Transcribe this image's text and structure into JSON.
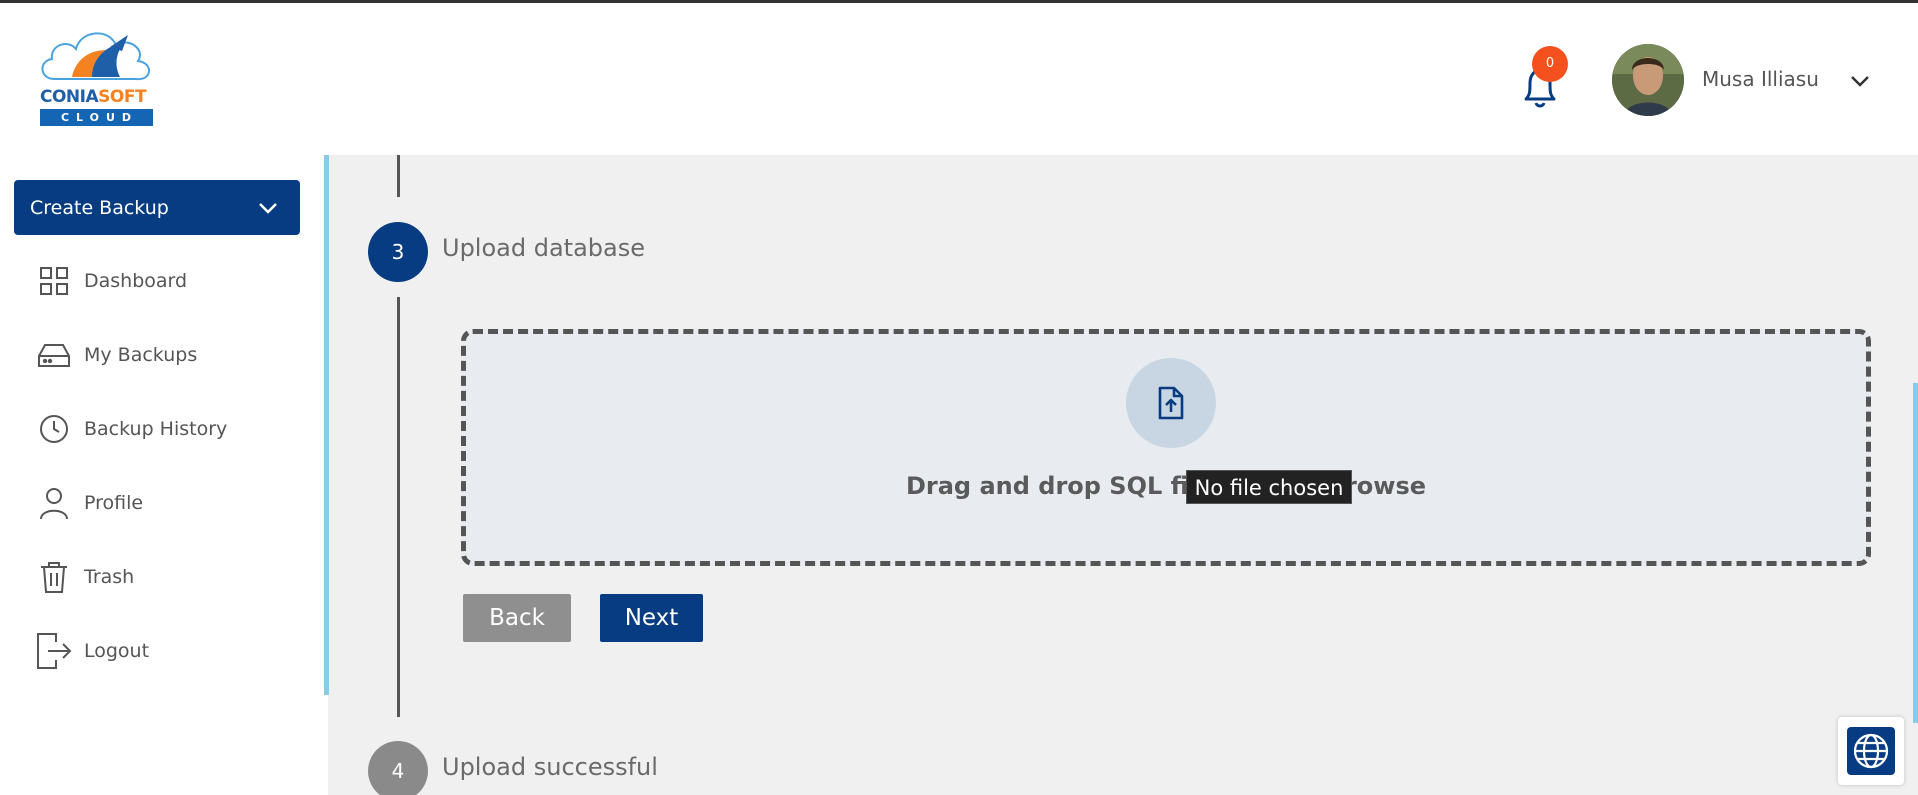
{
  "brand": {
    "logo_part1": "CONIA",
    "logo_part2": "SOFT",
    "logo_cloud": "CLOUD"
  },
  "header": {
    "notification_count": "0",
    "user_name": "Musa Illiasu"
  },
  "sidebar": {
    "create_backup_label": "Create Backup",
    "items": [
      {
        "label": "Dashboard",
        "icon": "grid-icon"
      },
      {
        "label": "My Backups",
        "icon": "drive-icon"
      },
      {
        "label": "Backup History",
        "icon": "clock-icon"
      },
      {
        "label": "Profile",
        "icon": "user-icon"
      },
      {
        "label": "Trash",
        "icon": "trash-icon"
      },
      {
        "label": "Logout",
        "icon": "logout-icon"
      }
    ]
  },
  "stepper": {
    "step3": {
      "number": "3",
      "label": "Upload database"
    },
    "step4": {
      "number": "4",
      "label": "Upload successful"
    }
  },
  "upload": {
    "dropzone_text": "Drag and drop SQL file here or browse",
    "tooltip": "No file chosen"
  },
  "actions": {
    "back_label": "Back",
    "next_label": "Next"
  },
  "colors": {
    "primary": "#073c82",
    "accent": "#88cbe8",
    "badge": "#f4511e"
  }
}
